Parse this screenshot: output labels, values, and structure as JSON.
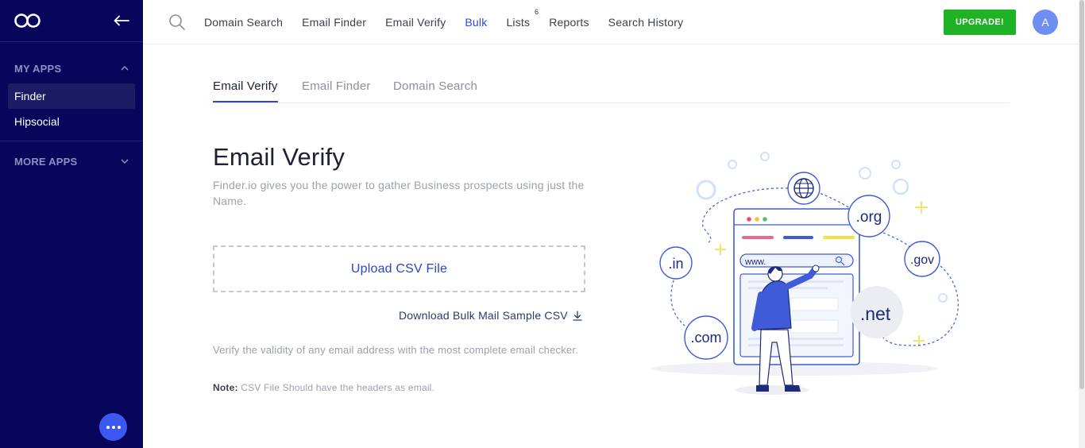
{
  "sidebar": {
    "my_apps_label": "MY APPS",
    "items": [
      {
        "label": "Finder",
        "active": true
      },
      {
        "label": "Hipsocial",
        "active": false
      }
    ],
    "more_apps_label": "MORE APPS"
  },
  "nav": {
    "links": [
      {
        "label": "Domain Search"
      },
      {
        "label": "Email Finder"
      },
      {
        "label": "Email Verify"
      },
      {
        "label": "Bulk",
        "active": true
      },
      {
        "label": "Lists",
        "badge": "6"
      },
      {
        "label": "Reports"
      },
      {
        "label": "Search History"
      }
    ],
    "upgrade_label": "UPGRADE!",
    "avatar_initial": "A"
  },
  "tabs": [
    {
      "label": "Email Verify",
      "active": true
    },
    {
      "label": "Email Finder"
    },
    {
      "label": "Domain Search"
    }
  ],
  "content": {
    "title": "Email Verify",
    "subtitle": "Finder.io gives you the power to gather Business prospects using just the Name.",
    "upload_label": "Upload CSV File",
    "download_label": "Download Bulk Mail Sample CSV",
    "verify_description": "Verify the validity of any email address with the most complete email checker.",
    "note_label": "Note:",
    "note_text": "CSV File Should have the headers as email."
  },
  "illustration": {
    "url_text": "www.",
    "domains": [
      ".org",
      ".in",
      ".gov",
      ".net",
      ".com"
    ]
  },
  "colors": {
    "sidebar_bg": "#08065a",
    "accent": "#2d48d8",
    "upgrade_green": "#1fb126",
    "chat_button": "#3b59f0"
  }
}
